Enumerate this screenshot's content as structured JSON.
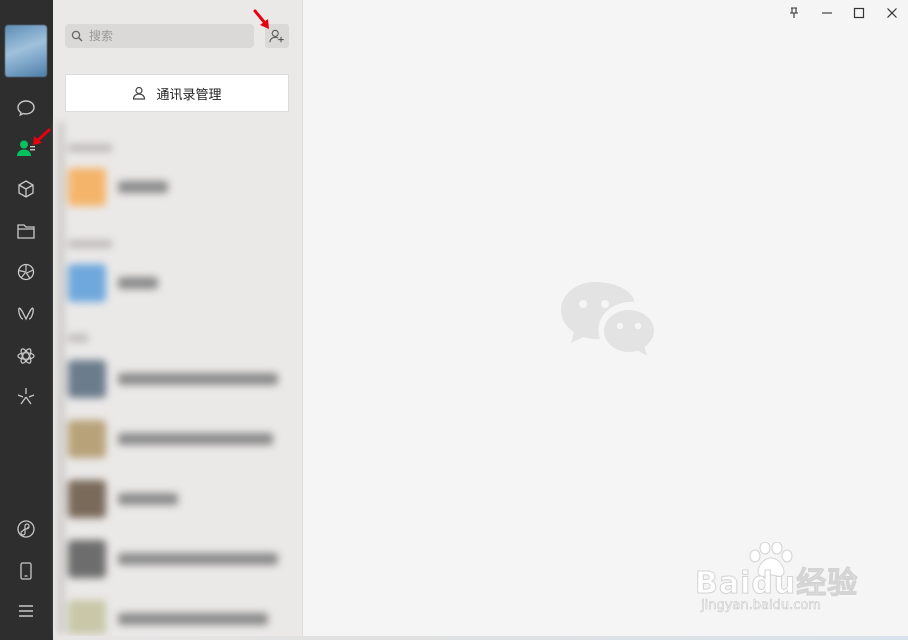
{
  "search": {
    "placeholder": "搜索",
    "value": ""
  },
  "contacts": {
    "manage_label": "通讯录管理"
  },
  "sidebar": {
    "items": [
      {
        "icon": "chat-icon"
      },
      {
        "icon": "contacts-icon",
        "active": true
      },
      {
        "icon": "favorites-icon"
      },
      {
        "icon": "folder-icon"
      },
      {
        "icon": "moments-icon"
      },
      {
        "icon": "channels-icon"
      },
      {
        "icon": "search-feature-icon"
      },
      {
        "icon": "topstories-icon"
      }
    ],
    "bottom_items": [
      {
        "icon": "miniprogram-icon"
      },
      {
        "icon": "phone-icon"
      },
      {
        "icon": "menu-icon"
      }
    ]
  },
  "window_controls": [
    "pin-icon",
    "minimize-icon",
    "maximize-icon",
    "close-icon"
  ],
  "watermark": {
    "brand": "Baidu经验",
    "url": "jingyan.baidu.com"
  },
  "colors": {
    "sidebar": "#2e2e2e",
    "accent_green": "#07c160",
    "annotation_red": "#e60012"
  }
}
